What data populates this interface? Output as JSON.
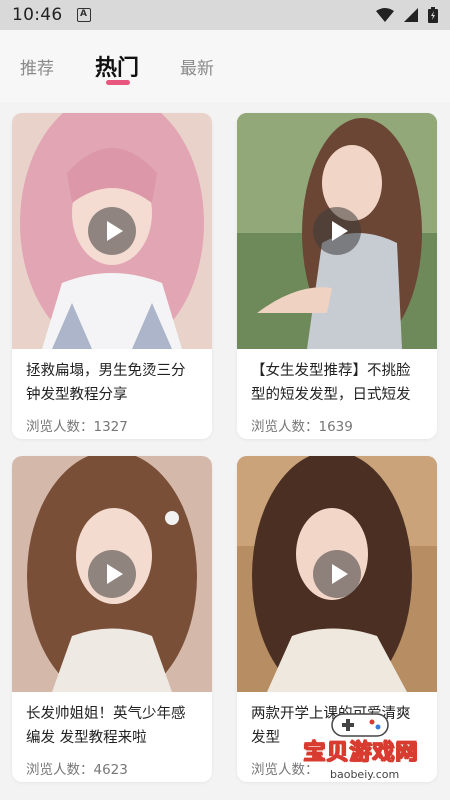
{
  "status_bar": {
    "time": "10:46",
    "notification_icon": "A"
  },
  "tabs": [
    {
      "label": "推荐"
    },
    {
      "label": "热门"
    },
    {
      "label": "最新"
    }
  ],
  "accent_color": "#e8557d",
  "cards": [
    {
      "title": "拯救扁塌，男生免烫三分钟发型教程分享",
      "views": "浏览人数：1327"
    },
    {
      "title": "【女生发型推荐】不挑脸型的短发发型，日式短发",
      "views": "浏览人数：1639"
    },
    {
      "title": "长发帅姐姐！英气少年感编发 发型教程来啦",
      "views": "浏览人数：4623"
    },
    {
      "title": "两款开学上课的可爱清爽发型",
      "views": "浏览人数："
    }
  ],
  "watermark": {
    "text": "宝贝游戏网",
    "url": "baobeiy.com"
  }
}
